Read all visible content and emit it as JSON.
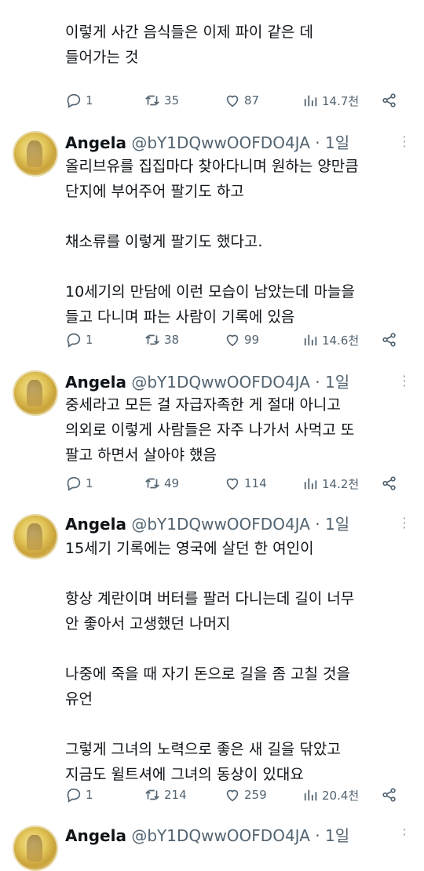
{
  "thread": {
    "top_partial": {
      "lines": [
        "이렇게 사간 음식들은 이제 파이 같은 데",
        "들어가는 것"
      ],
      "replies": "1",
      "retweets": "35",
      "likes": "87",
      "views": "14.7천"
    },
    "tweets": [
      {
        "name": "Angela",
        "handle": "@bY1DQwwOOFDO4JA · 1일",
        "paragraphs": [
          [
            "올리브유를 집집마다 찾아다니며 원하는 양만큼",
            "단지에 부어주어 팔기도 하고"
          ],
          [
            "채소류를 이렇게 팔기도 했다고."
          ],
          [
            "10세기의 만담에 이런 모습이 남았는데 마늘을",
            "들고 다니며 파는 사람이 기록에 있음"
          ]
        ],
        "replies": "1",
        "retweets": "38",
        "likes": "99",
        "views": "14.6천"
      },
      {
        "name": "Angela",
        "handle": "@bY1DQwwOOFDO4JA · 1일",
        "paragraphs": [
          [
            "중세라고 모든 걸 자급자족한 게 절대 아니고",
            "의외로 이렇게 사람들은 자주 나가서 사먹고 또",
            "팔고 하면서 살아야 했음"
          ]
        ],
        "replies": "1",
        "retweets": "49",
        "likes": "114",
        "views": "14.2천"
      },
      {
        "name": "Angela",
        "handle": "@bY1DQwwOOFDO4JA · 1일",
        "paragraphs": [
          [
            "15세기 기록에는 영국에 살던 한 여인이"
          ],
          [
            "항상 계란이며 버터를 팔러 다니는데 길이 너무",
            "안 좋아서 고생했던 나머지"
          ],
          [
            "나중에 죽을 때 자기 돈으로 길을 좀 고칠 것을",
            "유언"
          ],
          [
            "그렇게 그녀의 노력으로 좋은 새 길을 닦았고",
            "지금도 윌트셔에 그녀의 동상이 있대요"
          ]
        ],
        "replies": "1",
        "retweets": "214",
        "likes": "259",
        "views": "20.4천"
      },
      {
        "name": "Angela",
        "handle": "@bY1DQwwOOFDO4JA · 1일"
      }
    ]
  },
  "icons": {
    "reply": "reply-icon",
    "retweet": "retweet-icon",
    "like": "like-icon",
    "views": "views-icon",
    "share": "share-icon",
    "more": "more-icon"
  },
  "colors": {
    "text": "#0f1419",
    "muted": "#536471",
    "background": "#ffffff"
  }
}
